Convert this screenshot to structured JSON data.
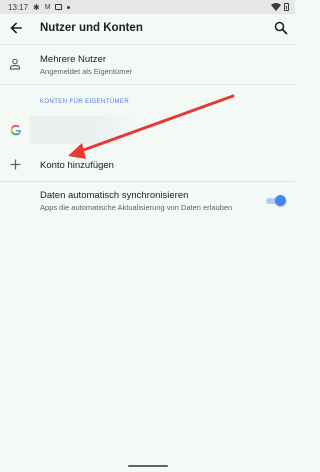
{
  "status_bar": {
    "time": "13:17",
    "icons": [
      "settings-icon",
      "gmail-icon",
      "photos-icon",
      "notification-dot-icon"
    ],
    "right_icons": [
      "wifi-icon",
      "battery-icon"
    ]
  },
  "app_bar": {
    "title": "Nutzer und Konten",
    "back_icon": "arrow-back-icon",
    "search_icon": "search-icon"
  },
  "multiple_users": {
    "title": "Mehrere Nutzer",
    "subtitle": "Angemeldet als Eigentümer",
    "icon": "person-icon"
  },
  "owner_section": {
    "header": "KONTEN FÜR EIGENTÜMER",
    "account_icon": "google-icon"
  },
  "add_account": {
    "label": "Konto hinzufügen",
    "icon": "plus-icon"
  },
  "sync": {
    "title": "Daten automatisch synchronisieren",
    "subtitle": "Apps die automatische Aktualisierung von Daten erlauben",
    "enabled": true
  },
  "colors": {
    "background": "#f3faf6",
    "accent": "#4285f4",
    "section_header": "#4a7bd6",
    "annotation_arrow": "#e53935"
  }
}
